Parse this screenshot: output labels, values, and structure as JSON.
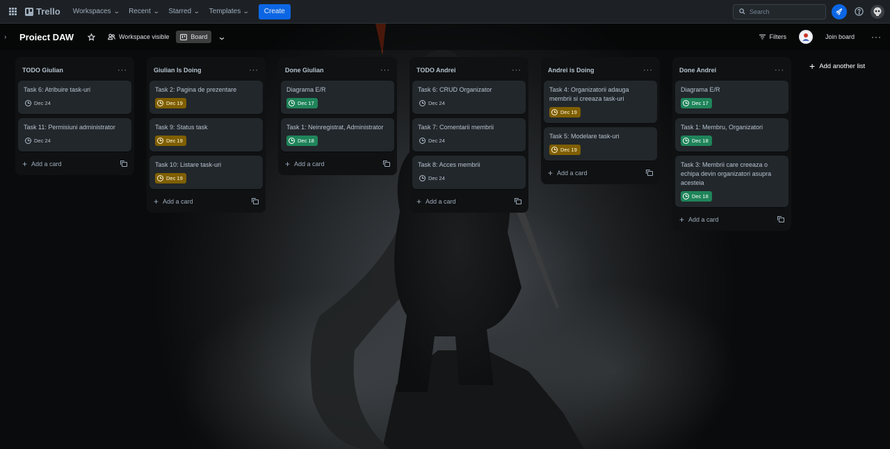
{
  "topnav": {
    "logo": "Trello",
    "menus": [
      {
        "label": "Workspaces"
      },
      {
        "label": "Recent"
      },
      {
        "label": "Starred"
      },
      {
        "label": "Templates"
      }
    ],
    "create_label": "Create",
    "search_placeholder": "Search"
  },
  "board": {
    "title": "Proiect DAW",
    "visibility": "Workspace visible",
    "view": "Board",
    "filters_label": "Filters",
    "join_label": "Join board",
    "add_list_label": "Add another list"
  },
  "colors": {
    "accent": "#0c66e4",
    "badge_yellow": "#7f5f01",
    "badge_green": "#1f845a"
  },
  "lists": [
    {
      "title": "TODO Giulian",
      "add_card": "Add a card",
      "cards": [
        {
          "title": "Task 6: Atribuire task-uri",
          "due": "Dec 24",
          "status": "plain"
        },
        {
          "title": "Task 11: Permisiuni administrator",
          "due": "Dec 24",
          "status": "plain"
        }
      ]
    },
    {
      "title": "Giulian Is Doing",
      "add_card": "Add a card",
      "cards": [
        {
          "title": "Task 2: Pagina de prezentare",
          "due": "Dec 19",
          "status": "yellow"
        },
        {
          "title": "Task 9: Status task",
          "due": "Dec 19",
          "status": "yellow"
        },
        {
          "title": "Task 10: Listare task-uri",
          "due": "Dec 19",
          "status": "yellow"
        }
      ]
    },
    {
      "title": "Done Giulian",
      "add_card": "Add a card",
      "cards": [
        {
          "title": "Diagrama E/R",
          "due": "Dec 17",
          "status": "green"
        },
        {
          "title": "Task 1: Neinregistrat, Administrator",
          "due": "Dec 18",
          "status": "green"
        }
      ]
    },
    {
      "title": "TODO Andrei",
      "add_card": "Add a card",
      "cards": [
        {
          "title": "Task 6: CRUD Organizator",
          "due": "Dec 24",
          "status": "plain"
        },
        {
          "title": "Task 7: Comentarii membrii",
          "due": "Dec 24",
          "status": "plain"
        },
        {
          "title": "Task 8: Acces membrii",
          "due": "Dec 24",
          "status": "plain"
        }
      ]
    },
    {
      "title": "Andrei is Doing",
      "add_card": "Add a card",
      "cards": [
        {
          "title": "Task 4: Organizatorii adauga membrii si creeaza task-uri",
          "due": "Dec 19",
          "status": "yellow"
        },
        {
          "title": "Task 5: Modelare task-uri",
          "due": "Dec 19",
          "status": "yellow"
        }
      ]
    },
    {
      "title": "Done Andrei",
      "add_card": "Add a card",
      "cards": [
        {
          "title": "Diagrama E/R",
          "due": "Dec 17",
          "status": "green"
        },
        {
          "title": "Task 1: Membru, Organizatori",
          "due": "Dec 18",
          "status": "green"
        },
        {
          "title": "Task 3: Membrii care creeaza o echipa devin organizatori asupra acesteia",
          "due": "Dec 18",
          "status": "green"
        }
      ]
    }
  ]
}
